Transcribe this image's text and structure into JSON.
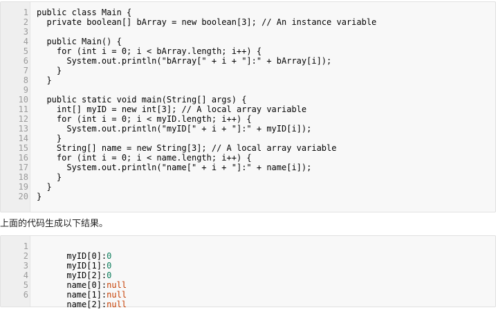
{
  "code_block": {
    "line_numbers": [
      "1",
      "2",
      "3",
      "4",
      "5",
      "6",
      "7",
      "8",
      "9",
      "10",
      "11",
      "12",
      "13",
      "14",
      "15",
      "16",
      "17",
      "18",
      "19",
      "20"
    ],
    "lines": [
      "public class Main {",
      "  private boolean[] bArray = new boolean[3]; // An instance variable",
      "",
      "  public Main() {",
      "    for (int i = 0; i < bArray.length; i++) {",
      "      System.out.println(\"bArray[\" + i + \"]:\" + bArray[i]);",
      "    }",
      "  }",
      "",
      "  public static void main(String[] args) {",
      "    int[] myID = new int[3]; // A local array variable",
      "    for (int i = 0; i < myID.length; i++) {",
      "      System.out.println(\"myID[\" + i + \"]:\" + myID[i]);",
      "    }",
      "    String[] name = new String[3]; // A local array variable",
      "    for (int i = 0; i < name.length; i++) {",
      "      System.out.println(\"name[\" + i + \"]:\" + name[i]);",
      "    }",
      "  }",
      "}"
    ]
  },
  "caption": "上面的代码生成以下结果。",
  "output_block": {
    "line_numbers": [
      "1",
      "2",
      "3",
      "4",
      "5",
      "6"
    ],
    "lines": [
      {
        "label": "myID[0]:",
        "value": "0"
      },
      {
        "label": "myID[1]:",
        "value": "0"
      },
      {
        "label": "myID[2]:",
        "value": "0"
      },
      {
        "label": "name[0]:",
        "value": "null"
      },
      {
        "label": "name[1]:",
        "value": "null"
      },
      {
        "label": "name[2]:",
        "value": "null"
      }
    ]
  }
}
